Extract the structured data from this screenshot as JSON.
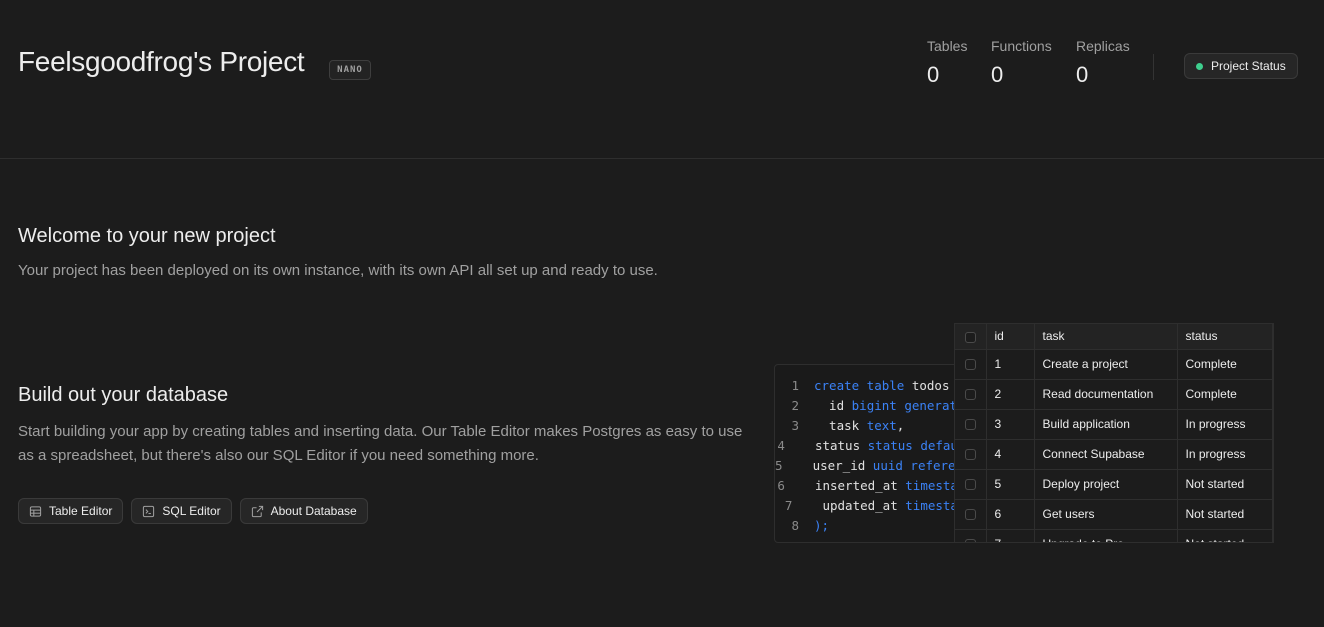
{
  "header": {
    "title": "Feelsgoodfrog's Project",
    "badge": "NANO",
    "stats": [
      {
        "label": "Tables",
        "value": "0"
      },
      {
        "label": "Functions",
        "value": "0"
      },
      {
        "label": "Replicas",
        "value": "0"
      }
    ],
    "status_button": "Project Status",
    "status_color": "#3ecf8e"
  },
  "welcome": {
    "title": "Welcome to your new project",
    "description": "Your project has been deployed on its own instance, with its own API all set up and ready to use."
  },
  "build": {
    "title": "Build out your database",
    "description": "Start building your app by creating tables and inserting data. Our Table Editor makes Postgres as easy to use as a spreadsheet, but there's also our SQL Editor if you need something more.",
    "buttons": [
      {
        "label": "Table Editor",
        "icon": "table-icon"
      },
      {
        "label": "SQL Editor",
        "icon": "terminal-icon"
      },
      {
        "label": "About Database",
        "icon": "external-link-icon"
      }
    ]
  },
  "code": {
    "lines": [
      {
        "n": "1",
        "kw1": "create table",
        "t1": " todos ("
      },
      {
        "n": "2",
        "t0": "  id ",
        "kw1": "bigint generated",
        "t1": ""
      },
      {
        "n": "3",
        "t0": "  task ",
        "kw1": "text",
        "t1": ","
      },
      {
        "n": "4",
        "t0": "  status ",
        "kw1": "status default",
        "t1": ""
      },
      {
        "n": "5",
        "t0": "  user_id ",
        "kw1": "uuid references",
        "t1": ""
      },
      {
        "n": "6",
        "t0": "  inserted_at ",
        "kw1": "timestamp",
        "t1": ""
      },
      {
        "n": "7",
        "t0": "  updated_at ",
        "kw1": "timestamp",
        "t1": ""
      },
      {
        "n": "8",
        "kw1": ");",
        "t1": ""
      }
    ]
  },
  "grid": {
    "columns": [
      "id",
      "task",
      "status"
    ],
    "rows": [
      {
        "id": "1",
        "task": "Create a project",
        "status": "Complete"
      },
      {
        "id": "2",
        "task": "Read documentation",
        "status": "Complete"
      },
      {
        "id": "3",
        "task": "Build application",
        "status": "In progress"
      },
      {
        "id": "4",
        "task": "Connect Supabase",
        "status": "In progress"
      },
      {
        "id": "5",
        "task": "Deploy project",
        "status": "Not started"
      },
      {
        "id": "6",
        "task": "Get users",
        "status": "Not started"
      },
      {
        "id": "7",
        "task": "Upgrade to Pro",
        "status": "Not started"
      }
    ]
  }
}
